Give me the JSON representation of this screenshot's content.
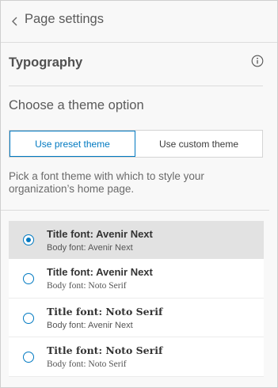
{
  "header": {
    "back_icon": "chevron-left-icon",
    "title": "Page settings"
  },
  "typography": {
    "title": "Typography",
    "info_icon": "info-circle-icon"
  },
  "theme": {
    "choose_label": "Choose a theme option",
    "tabs": [
      {
        "label": "Use preset theme",
        "selected": true
      },
      {
        "label": "Use custom theme",
        "selected": false
      }
    ],
    "accent_color": "#0079c1"
  },
  "description": "Pick a font theme with which to style your organization’s home page.",
  "font_options": [
    {
      "title": "Title font: Avenir Next",
      "body": "Body font: Avenir Next",
      "selected": true
    },
    {
      "title": "Title font: Avenir Next",
      "body": "Body font: Noto Serif",
      "selected": false
    },
    {
      "title": "Title font: Noto Serif",
      "body": "Body font: Avenir Next",
      "selected": false
    },
    {
      "title": "Title font: Noto Serif",
      "body": "Body font: Noto Serif",
      "selected": false
    }
  ]
}
